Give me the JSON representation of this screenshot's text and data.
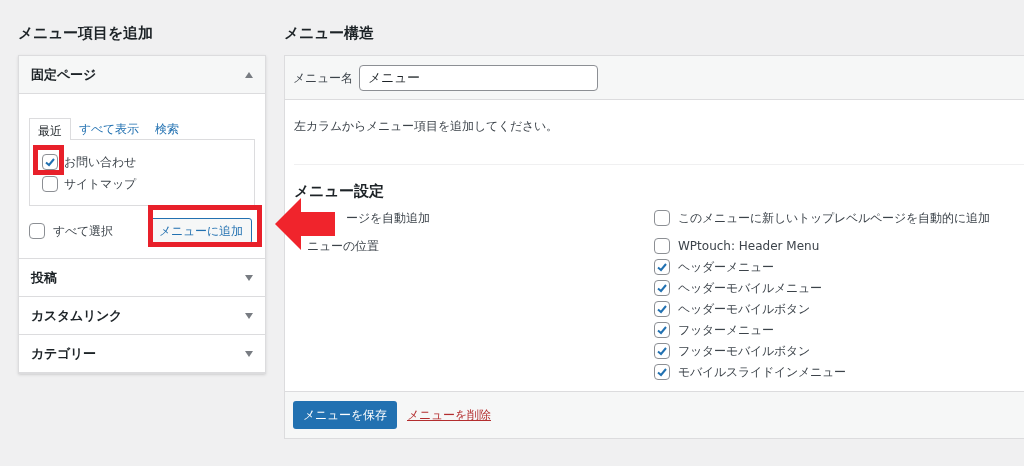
{
  "add_items": {
    "title": "メニュー項目を追加",
    "sections": [
      {
        "title": "固定ページ",
        "expanded": true,
        "tabs": [
          {
            "label": "最近",
            "selected": true
          },
          {
            "label": "すべて表示",
            "selected": false
          },
          {
            "label": "検索",
            "selected": false
          }
        ],
        "items": [
          {
            "label": "お問い合わせ",
            "checked": true
          },
          {
            "label": "サイトマップ",
            "checked": false
          }
        ],
        "select_all": {
          "label": "すべて選択",
          "checked": false
        },
        "add_button": "メニューに追加"
      },
      {
        "title": "投稿",
        "expanded": false
      },
      {
        "title": "カスタムリンク",
        "expanded": false
      },
      {
        "title": "カテゴリー",
        "expanded": false
      }
    ]
  },
  "structure": {
    "title": "メニュー構造",
    "name_label": "メニュー名",
    "name_value": "メニュー",
    "instructions": "左カラムからメニュー項目を追加してください。",
    "settings": {
      "title": "メニュー設定",
      "rows": [
        {
          "label": "ージを自動追加",
          "options": [
            {
              "label": "このメニューに新しいトップレベルページを自動的に追加",
              "checked": false
            }
          ]
        },
        {
          "label": "ニューの位置",
          "options": [
            {
              "label": "WPtouch: Header Menu",
              "checked": false
            },
            {
              "label": "ヘッダーメニュー",
              "checked": true
            },
            {
              "label": "ヘッダーモバイルメニュー",
              "checked": true
            },
            {
              "label": "ヘッダーモバイルボタン",
              "checked": true
            },
            {
              "label": "フッターメニュー",
              "checked": true
            },
            {
              "label": "フッターモバイルボタン",
              "checked": true
            },
            {
              "label": "モバイルスライドインメニュー",
              "checked": true
            }
          ]
        }
      ]
    },
    "save_button": "メニューを保存",
    "delete_link": "メニューを削除"
  }
}
